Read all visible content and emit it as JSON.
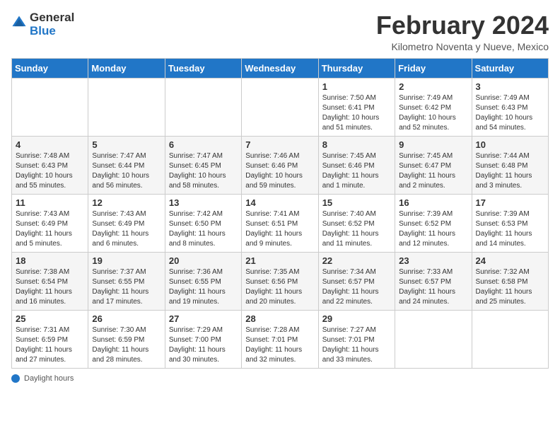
{
  "header": {
    "logo_general": "General",
    "logo_blue": "Blue",
    "month_title": "February 2024",
    "location": "Kilometro Noventa y Nueve, Mexico"
  },
  "days_of_week": [
    "Sunday",
    "Monday",
    "Tuesday",
    "Wednesday",
    "Thursday",
    "Friday",
    "Saturday"
  ],
  "weeks": [
    [
      {
        "day": "",
        "info": ""
      },
      {
        "day": "",
        "info": ""
      },
      {
        "day": "",
        "info": ""
      },
      {
        "day": "",
        "info": ""
      },
      {
        "day": "1",
        "info": "Sunrise: 7:50 AM\nSunset: 6:41 PM\nDaylight: 10 hours and 51 minutes."
      },
      {
        "day": "2",
        "info": "Sunrise: 7:49 AM\nSunset: 6:42 PM\nDaylight: 10 hours and 52 minutes."
      },
      {
        "day": "3",
        "info": "Sunrise: 7:49 AM\nSunset: 6:43 PM\nDaylight: 10 hours and 54 minutes."
      }
    ],
    [
      {
        "day": "4",
        "info": "Sunrise: 7:48 AM\nSunset: 6:43 PM\nDaylight: 10 hours and 55 minutes."
      },
      {
        "day": "5",
        "info": "Sunrise: 7:47 AM\nSunset: 6:44 PM\nDaylight: 10 hours and 56 minutes."
      },
      {
        "day": "6",
        "info": "Sunrise: 7:47 AM\nSunset: 6:45 PM\nDaylight: 10 hours and 58 minutes."
      },
      {
        "day": "7",
        "info": "Sunrise: 7:46 AM\nSunset: 6:46 PM\nDaylight: 10 hours and 59 minutes."
      },
      {
        "day": "8",
        "info": "Sunrise: 7:45 AM\nSunset: 6:46 PM\nDaylight: 11 hours and 1 minute."
      },
      {
        "day": "9",
        "info": "Sunrise: 7:45 AM\nSunset: 6:47 PM\nDaylight: 11 hours and 2 minutes."
      },
      {
        "day": "10",
        "info": "Sunrise: 7:44 AM\nSunset: 6:48 PM\nDaylight: 11 hours and 3 minutes."
      }
    ],
    [
      {
        "day": "11",
        "info": "Sunrise: 7:43 AM\nSunset: 6:49 PM\nDaylight: 11 hours and 5 minutes."
      },
      {
        "day": "12",
        "info": "Sunrise: 7:43 AM\nSunset: 6:49 PM\nDaylight: 11 hours and 6 minutes."
      },
      {
        "day": "13",
        "info": "Sunrise: 7:42 AM\nSunset: 6:50 PM\nDaylight: 11 hours and 8 minutes."
      },
      {
        "day": "14",
        "info": "Sunrise: 7:41 AM\nSunset: 6:51 PM\nDaylight: 11 hours and 9 minutes."
      },
      {
        "day": "15",
        "info": "Sunrise: 7:40 AM\nSunset: 6:52 PM\nDaylight: 11 hours and 11 minutes."
      },
      {
        "day": "16",
        "info": "Sunrise: 7:39 AM\nSunset: 6:52 PM\nDaylight: 11 hours and 12 minutes."
      },
      {
        "day": "17",
        "info": "Sunrise: 7:39 AM\nSunset: 6:53 PM\nDaylight: 11 hours and 14 minutes."
      }
    ],
    [
      {
        "day": "18",
        "info": "Sunrise: 7:38 AM\nSunset: 6:54 PM\nDaylight: 11 hours and 16 minutes."
      },
      {
        "day": "19",
        "info": "Sunrise: 7:37 AM\nSunset: 6:55 PM\nDaylight: 11 hours and 17 minutes."
      },
      {
        "day": "20",
        "info": "Sunrise: 7:36 AM\nSunset: 6:55 PM\nDaylight: 11 hours and 19 minutes."
      },
      {
        "day": "21",
        "info": "Sunrise: 7:35 AM\nSunset: 6:56 PM\nDaylight: 11 hours and 20 minutes."
      },
      {
        "day": "22",
        "info": "Sunrise: 7:34 AM\nSunset: 6:57 PM\nDaylight: 11 hours and 22 minutes."
      },
      {
        "day": "23",
        "info": "Sunrise: 7:33 AM\nSunset: 6:57 PM\nDaylight: 11 hours and 24 minutes."
      },
      {
        "day": "24",
        "info": "Sunrise: 7:32 AM\nSunset: 6:58 PM\nDaylight: 11 hours and 25 minutes."
      }
    ],
    [
      {
        "day": "25",
        "info": "Sunrise: 7:31 AM\nSunset: 6:59 PM\nDaylight: 11 hours and 27 minutes."
      },
      {
        "day": "26",
        "info": "Sunrise: 7:30 AM\nSunset: 6:59 PM\nDaylight: 11 hours and 28 minutes."
      },
      {
        "day": "27",
        "info": "Sunrise: 7:29 AM\nSunset: 7:00 PM\nDaylight: 11 hours and 30 minutes."
      },
      {
        "day": "28",
        "info": "Sunrise: 7:28 AM\nSunset: 7:01 PM\nDaylight: 11 hours and 32 minutes."
      },
      {
        "day": "29",
        "info": "Sunrise: 7:27 AM\nSunset: 7:01 PM\nDaylight: 11 hours and 33 minutes."
      },
      {
        "day": "",
        "info": ""
      },
      {
        "day": "",
        "info": ""
      }
    ]
  ],
  "footer": {
    "daylight_label": "Daylight hours"
  }
}
